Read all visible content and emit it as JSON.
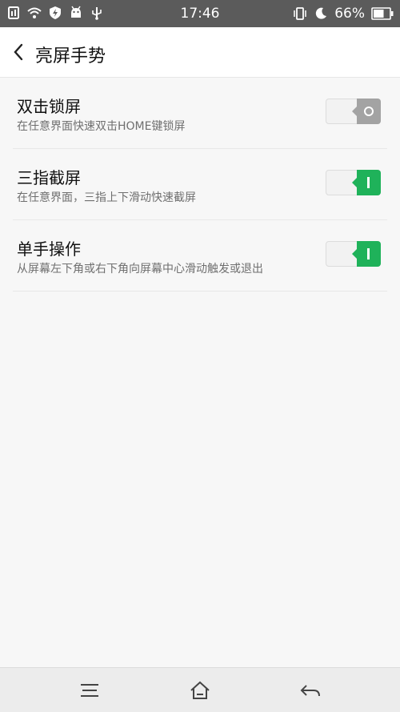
{
  "status_bar": {
    "time": "17:46",
    "battery_percent": "66%",
    "battery_level": 0.66,
    "left_icons": [
      "sim-icon",
      "wifi-icon",
      "shield-icon",
      "android-icon",
      "usb-icon"
    ],
    "right_icons": [
      "vibrate-icon",
      "moon-icon",
      "battery-icon"
    ]
  },
  "app_bar": {
    "title": "亮屏手势",
    "back_icon": "chevron-left-icon"
  },
  "settings": [
    {
      "title": "双击锁屏",
      "description": "在任意界面快速双击HOME键锁屏",
      "enabled": false
    },
    {
      "title": "三指截屏",
      "description": "在任意界面，三指上下滑动快速截屏",
      "enabled": true
    },
    {
      "title": "单手操作",
      "description": "从屏幕左下角或右下角向屏幕中心滑动触发或退出",
      "enabled": true
    }
  ],
  "nav_bar": {
    "icons": [
      "menu-icon",
      "home-icon",
      "back-icon"
    ]
  },
  "colors": {
    "status_bar": "#5b5b5b",
    "toggle_on": "#1fb25a",
    "toggle_off": "#a3a3a3",
    "background": "#f7f7f7"
  }
}
